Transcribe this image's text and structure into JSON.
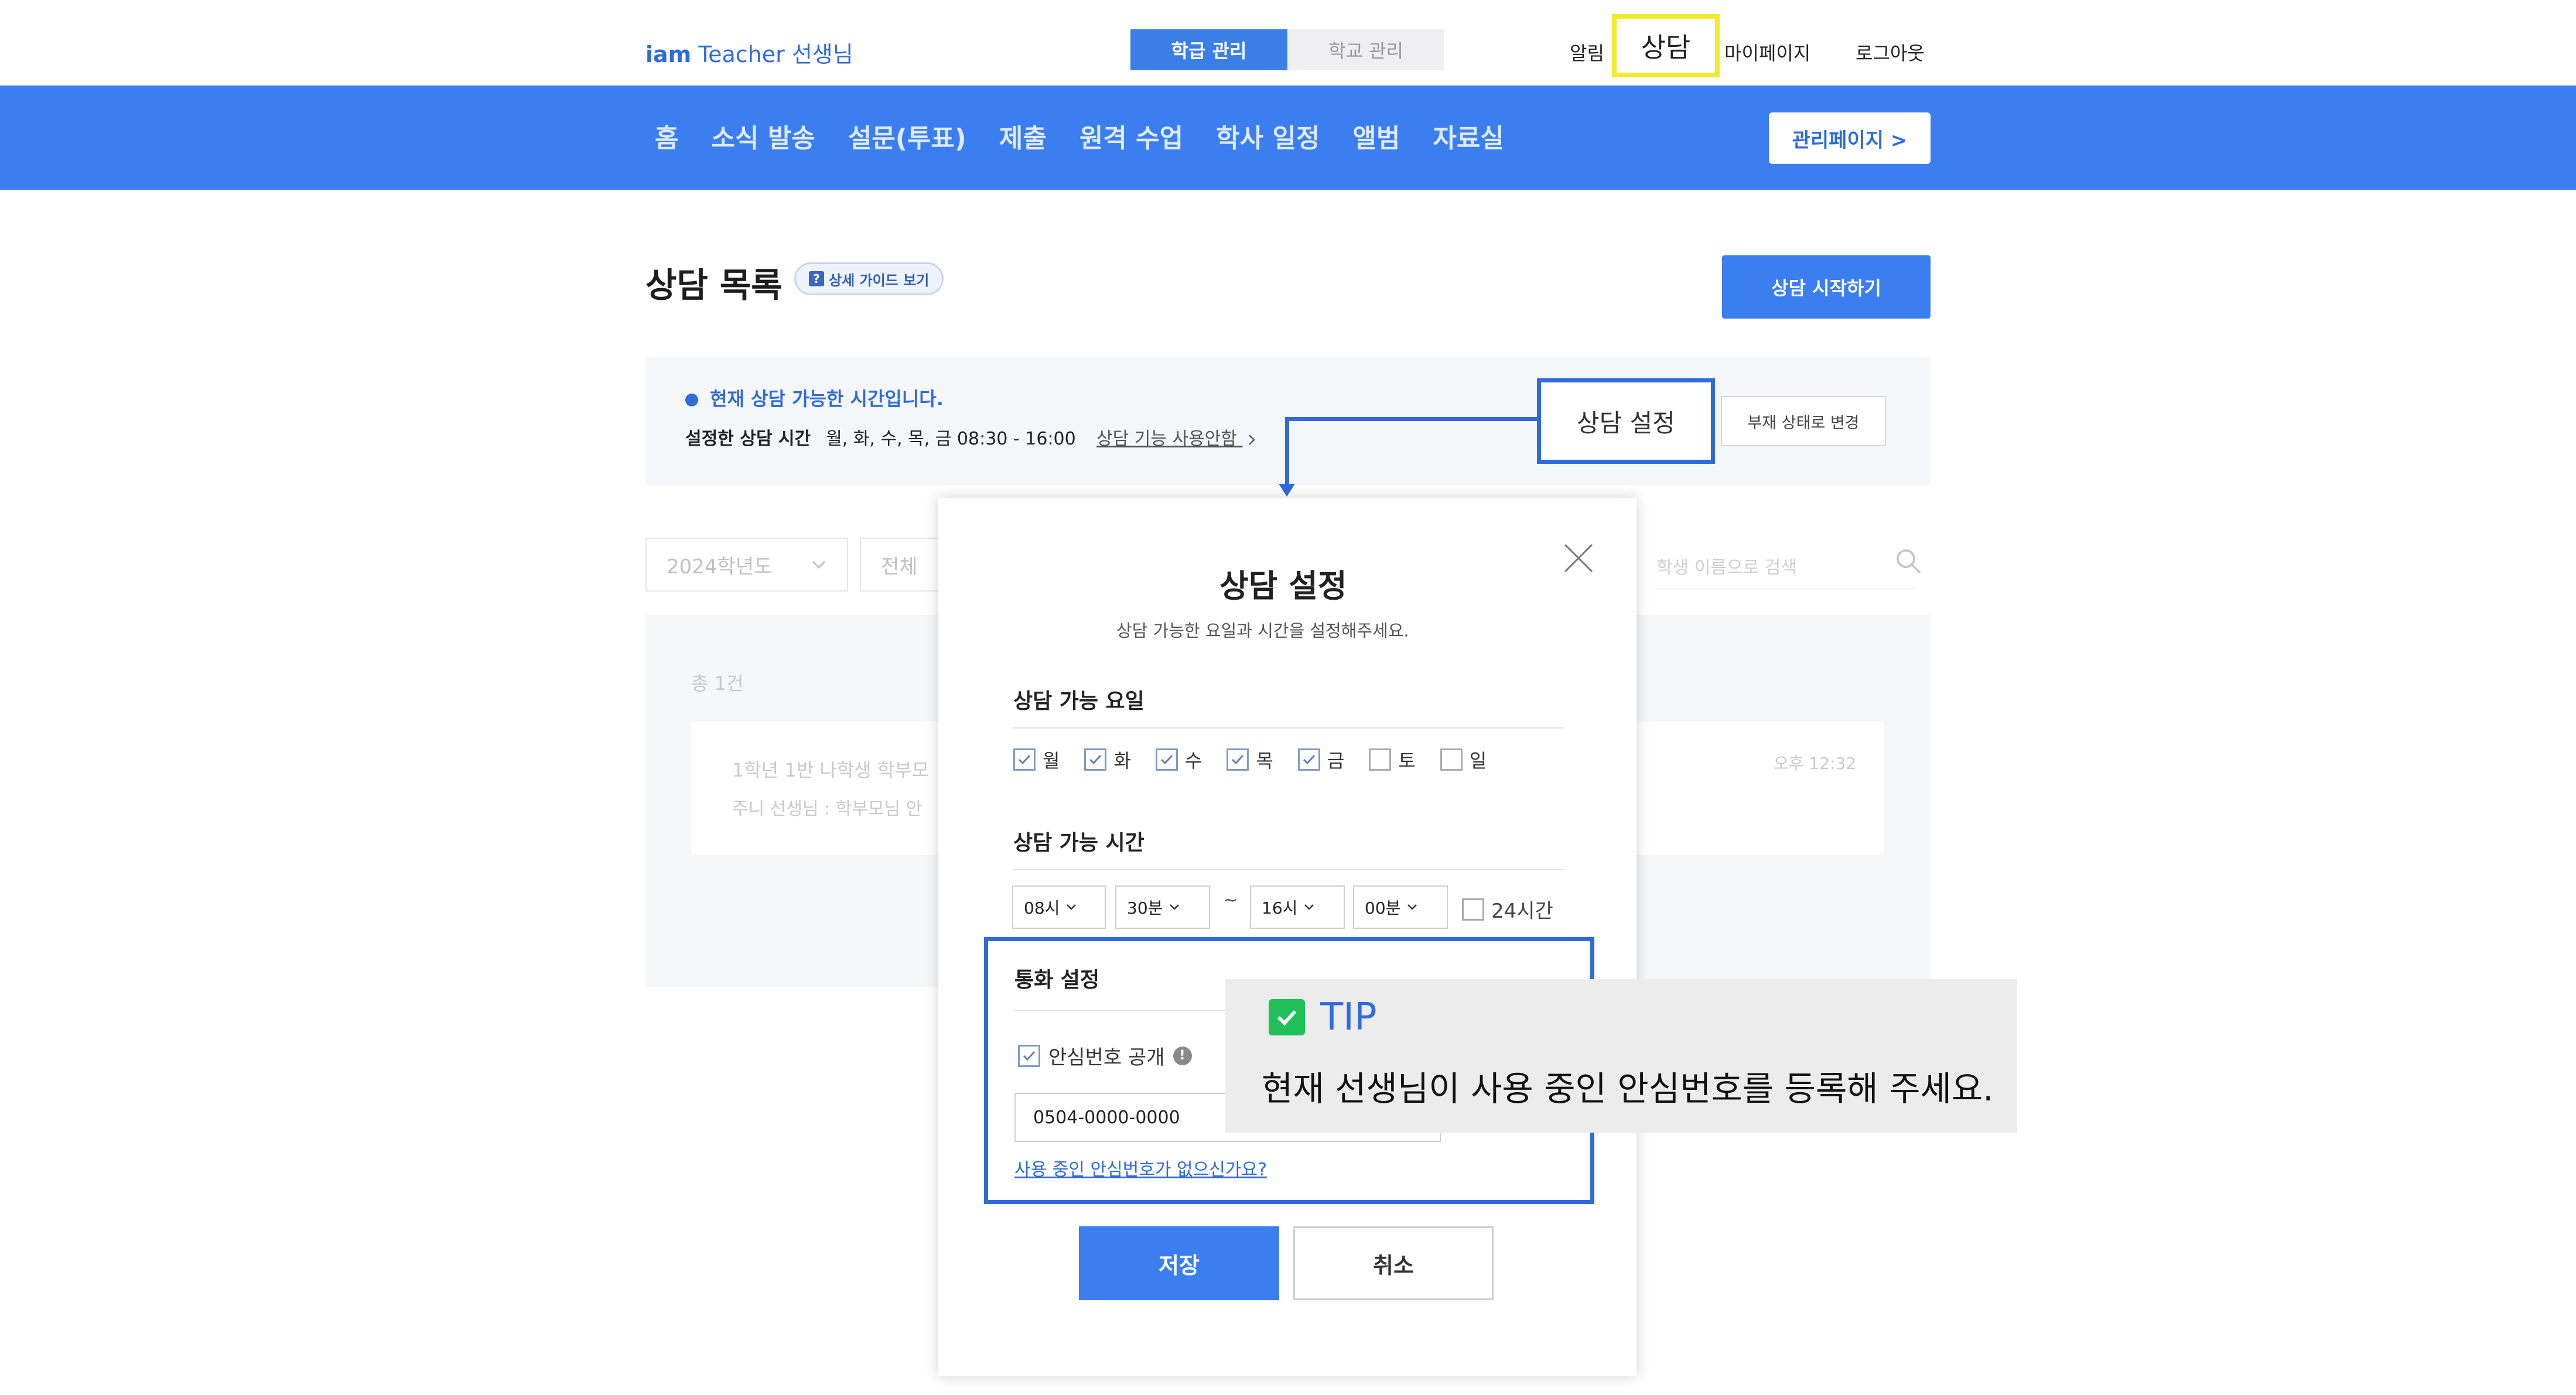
{
  "header": {
    "brand_iam": "iam",
    "brand_rest": "Teacher 선생님",
    "tabs": [
      "학급 관리",
      "학교 관리"
    ],
    "notice": "알림",
    "consult": "상담",
    "mypage": "마이페이지",
    "logout": "로그아웃"
  },
  "nav": {
    "items": [
      "홈",
      "소식 발송",
      "설문(투표)",
      "제출",
      "원격 수업",
      "학사 일정",
      "앨범",
      "자료실"
    ],
    "admin": "관리페이지 >"
  },
  "page": {
    "title": "상담 목록",
    "guide": "상세 가이드 보기",
    "guide_icon": "?",
    "start": "상담 시작하기",
    "available": "현재 상담 가능한 시간입니다.",
    "set_time_label": "설정한 상담 시간",
    "set_time_value": "월, 화, 수, 목, 금 08:30 - 16:00",
    "usage": "상담 기능 사용안함",
    "settings": "상담 설정",
    "absent": "부재 상태로 변경",
    "year": "2024학년도",
    "filter": "전체",
    "search_placeholder": "학생 이름으로 검색",
    "total": "총 1건",
    "card_title": "1학년   1반 나학생 학부모",
    "card_sub": "주니 선생님 : 학부모님 안",
    "card_time": "오후 12:32"
  },
  "modal": {
    "title": "상담 설정",
    "subtitle": "상담 가능한 요일과 시간을 설정해주세요.",
    "days_title": "상담 가능 요일",
    "days": [
      {
        "label": "월",
        "checked": true
      },
      {
        "label": "화",
        "checked": true
      },
      {
        "label": "수",
        "checked": true
      },
      {
        "label": "목",
        "checked": true
      },
      {
        "label": "금",
        "checked": true
      },
      {
        "label": "토",
        "checked": false
      },
      {
        "label": "일",
        "checked": false
      }
    ],
    "time_title": "상담 가능 시간",
    "start_hour": "08시",
    "start_min": "30분",
    "tilde": "~",
    "end_hour": "16시",
    "end_min": "00분",
    "all_day": "24시간",
    "call_title": "통화 설정",
    "safe_number": "안심번호 공개",
    "phone": "0504-0000-0000",
    "no_phone": "사용 중인 안심번호가 없으신가요?",
    "save": "저장",
    "cancel": "취소"
  },
  "tip": {
    "title": "TIP",
    "text": "현재 선생님이 사용 중인 안심번호를 등록해 주세요."
  },
  "colors": {
    "primary": "#3a7ef0",
    "highlight": "#f2ea2a",
    "tip_green": "#1fbf5a"
  }
}
